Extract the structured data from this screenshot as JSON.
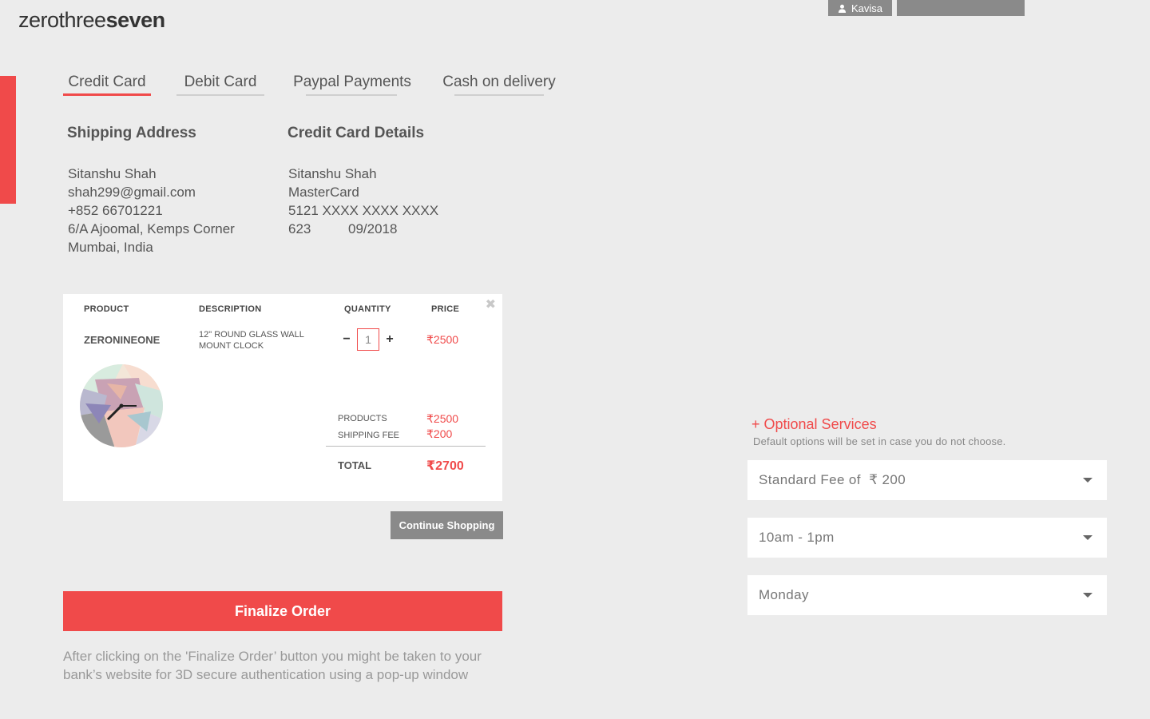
{
  "header": {
    "logo_light": "zerothree",
    "logo_bold": "seven",
    "user_name": "Kavisa"
  },
  "tabs": [
    {
      "label": "Credit Card",
      "active": true
    },
    {
      "label": "Debit Card",
      "active": false
    },
    {
      "label": "Paypal Payments",
      "active": false
    },
    {
      "label": "Cash on delivery",
      "active": false
    }
  ],
  "shipping": {
    "title": "Shipping Address",
    "lines": [
      "Sitanshu Shah",
      "shah299@gmail.com",
      "+852 66701221",
      "6/A Ajoomal, Kemps Corner",
      "Mumbai, India"
    ]
  },
  "card_details": {
    "title": "Credit Card Details",
    "name": "Sitanshu Shah",
    "brand": "MasterCard",
    "number": "5121 XXXX XXXX XXXX",
    "cvv": "623",
    "expiry": "09/2018"
  },
  "cart": {
    "headers": {
      "product": "PRODUCT",
      "description": "DESCRIPTION",
      "quantity": "QUANTITY",
      "price": "PRICE"
    },
    "item": {
      "name": "ZERONINEONE",
      "description": "12\" ROUND GLASS WALL MOUNT CLOCK",
      "quantity": "1",
      "price": "2500"
    },
    "currency_symbol": "₹",
    "summary": {
      "products_label": "PRODUCTS",
      "products_value": "2500",
      "shipping_label": "SHIPPING FEE",
      "shipping_value": "200",
      "total_label": "TOTAL",
      "total_value": "2700"
    }
  },
  "actions": {
    "continue_label": "Continue Shopping",
    "finalize_label": "Finalize Order",
    "finalize_note": "After clicking on the 'Finalize Order’ button you might be taken to your bank’s website for 3D secure authentication using a pop-up window"
  },
  "optional_services": {
    "title": "+ Optional Services",
    "subtitle": "Default options will be set in case you do not choose.",
    "selects": [
      {
        "value": "Standard Fee of  ₹ 200"
      },
      {
        "value": "10am - 1pm"
      },
      {
        "value": "Monday"
      }
    ]
  },
  "colors": {
    "accent": "#f04a4a",
    "background": "#ececec",
    "muted_button": "#8a8a8a"
  },
  "icons": {
    "user": "user-icon",
    "close": "close-icon",
    "minus": "minus-icon",
    "plus": "plus-icon",
    "caret": "chevron-down-icon"
  }
}
